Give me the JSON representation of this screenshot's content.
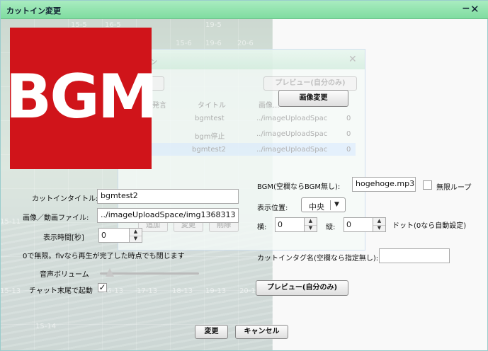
{
  "window": {
    "title": "カットイン変更"
  },
  "background_dialog": {
    "title_partial": "ン",
    "preview_label": "プレビュー(自分のみ)",
    "columns": [
      "発言",
      "タイトル",
      "画像..."
    ],
    "rows": [
      {
        "title": "bgmtest",
        "path": "../imageUploadSpac",
        "num": "0"
      },
      {
        "title": "bgm停止",
        "path": "../imageUploadSpac",
        "num": "0"
      },
      {
        "title": "bgmtest2",
        "path": "../imageUploadSpac",
        "num": "0"
      }
    ],
    "buttons": [
      "追加",
      "変更",
      "削除"
    ]
  },
  "image_change_button": "画像変更",
  "logo_text": "BGM",
  "form": {
    "cutin_title_label": "カットインタイトル:",
    "cutin_title_value": "bgmtest2",
    "image_file_label": "画像／動画ファイル:",
    "image_file_value": "../imageUploadSpace/img1368313",
    "display_time_label": "表示時間[秒]",
    "display_time_value": "0",
    "display_note": "0で無限。flvなら再生が完了した時点でも閉じます",
    "volume_label": "音声ボリューム",
    "volume_level": 0.1,
    "chat_start_label": "チャット末尾で起動",
    "chat_start_checked": "✓",
    "bgm_label": "BGM(空欄ならBGM無し):",
    "bgm_value": "hogehoge.mp3",
    "loop_label": "無限ループ",
    "position_label": "表示位置:",
    "position_value": "中央",
    "x_label": "横:",
    "x_value": "0",
    "y_label": "縦:",
    "y_value": "0",
    "dot_note": "ドット(0なら自動設定)",
    "tag_label": "カットインタグ名(空欄なら指定無し):",
    "tag_value": "",
    "preview_button": "プレビュー(自分のみ)",
    "ok_button": "変更",
    "cancel_button": "キャンセル"
  },
  "map_numbers": [
    "15-5",
    "16-5",
    "19-5",
    "19-6",
    "20-6",
    "15-6",
    "15-11",
    "15-13",
    "15-14",
    "16-13",
    "17-13",
    "18-13",
    "19-13",
    "20-13"
  ]
}
